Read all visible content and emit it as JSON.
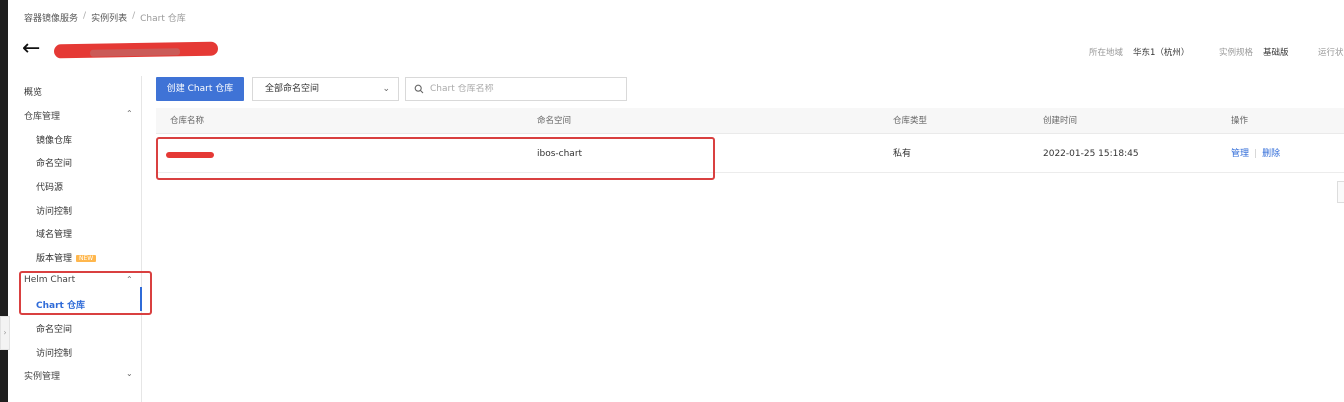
{
  "breadcrumb": {
    "item1": "容器镜像服务",
    "sep1": "/",
    "item2": "实例列表",
    "sep2": "/",
    "current": "Chart 仓库"
  },
  "header": {
    "back_icon": "arrow-left-icon",
    "region_label": "所在地域",
    "region_value": "华东1（杭州）",
    "spec_label": "实例规格",
    "spec_value": "基础版",
    "status_label": "运行状"
  },
  "sidebar": {
    "overview": "概览",
    "repo_mgmt": "仓库管理",
    "image_repo": "镜像仓库",
    "namespace": "命名空间",
    "code_source": "代码源",
    "access_control": "访问控制",
    "domain_mgmt": "域名管理",
    "version_mgmt": "版本管理",
    "version_badge": "NEW",
    "helm_chart": "Helm Chart",
    "chart_repo": "Chart 仓库",
    "helm_namespace": "命名空间",
    "helm_access_control": "访问控制",
    "instance_mgmt": "实例管理",
    "collapse_icon": "chevron-up-icon",
    "expand_icon": "chevron-down-icon"
  },
  "toolbar": {
    "create_button": "创建 Chart 仓库",
    "namespace_select": "全部命名空间",
    "search_placeholder": "Chart 仓库名称"
  },
  "table": {
    "columns": {
      "name": "仓库名称",
      "namespace": "命名空间",
      "type": "仓库类型",
      "created": "创建时间",
      "actions": "操作"
    },
    "rows": [
      {
        "name": "",
        "namespace": "ibos-chart",
        "type": "私有",
        "created": "2022-01-25 15:18:45",
        "manage": "管理",
        "delete": "删除"
      }
    ]
  },
  "colors": {
    "primary": "#3f73d6",
    "link": "#2f6bd8",
    "annotation_red": "#d94040",
    "redaction": "#e53935"
  }
}
